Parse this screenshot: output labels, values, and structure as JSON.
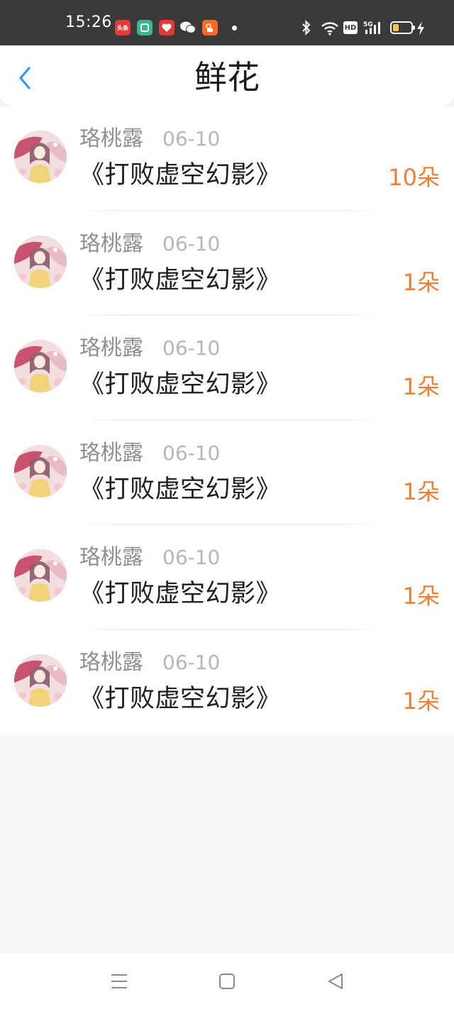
{
  "status_bar": {
    "time": "15:26",
    "apps": [
      {
        "icon": "toutiao-icon",
        "label": "头条",
        "color": "#e63a3a"
      },
      {
        "icon": "green-app-icon",
        "label": "",
        "color": "#3bb58a"
      },
      {
        "icon": "heart-app-icon",
        "label": "",
        "color": "#e03a3a"
      },
      {
        "icon": "wechat-icon",
        "label": "",
        "color": "#ffffff"
      },
      {
        "icon": "kuaishou-icon",
        "label": "",
        "color": "#ff6a1f"
      }
    ],
    "hd_label": "HD",
    "network_label": "5G",
    "battery_color": "#f2c94c"
  },
  "header": {
    "title": "鲜花",
    "back_icon": "chevron-left-icon",
    "accent_color": "#2b9df0"
  },
  "list": {
    "items": [
      {
        "name": "珞桃露",
        "date": "06-10",
        "book": "《打败虚空幻影》",
        "amount": "10朵"
      },
      {
        "name": "珞桃露",
        "date": "06-10",
        "book": "《打败虚空幻影》",
        "amount": "1朵"
      },
      {
        "name": "珞桃露",
        "date": "06-10",
        "book": "《打败虚空幻影》",
        "amount": "1朵"
      },
      {
        "name": "珞桃露",
        "date": "06-10",
        "book": "《打败虚空幻影》",
        "amount": "1朵"
      },
      {
        "name": "珞桃露",
        "date": "06-10",
        "book": "《打败虚空幻影》",
        "amount": "1朵"
      },
      {
        "name": "珞桃露",
        "date": "06-10",
        "book": "《打败虚空幻影》",
        "amount": "1朵"
      }
    ],
    "amount_color": "#f07f33"
  },
  "nav_bar": {
    "menu_icon": "menu-icon",
    "home_icon": "home-square-icon",
    "back_icon": "back-triangle-icon"
  }
}
